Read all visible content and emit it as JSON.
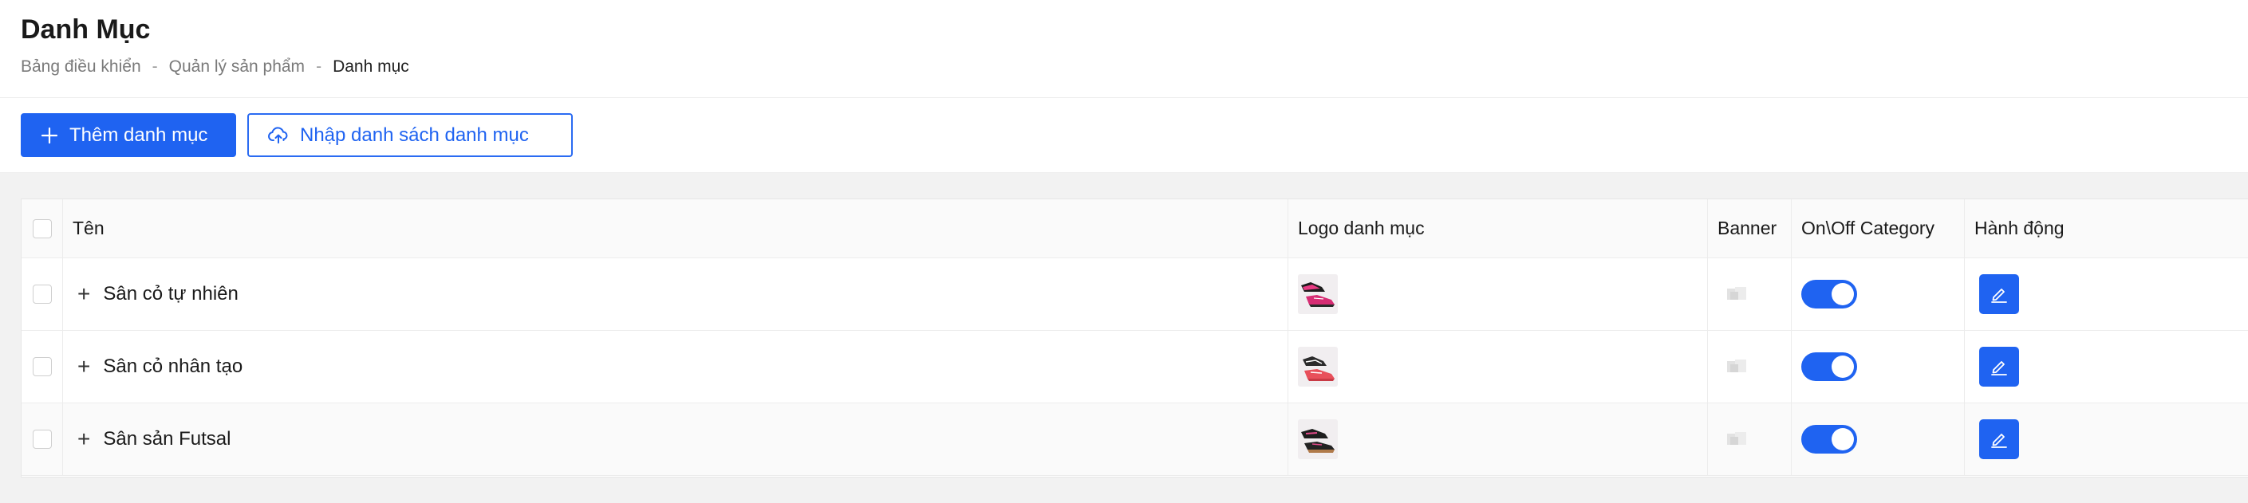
{
  "header": {
    "title": "Danh Mục",
    "breadcrumb": [
      "Bảng điều khiển",
      "Quản lý sản phẩm",
      "Danh mục"
    ],
    "separator": "-"
  },
  "toolbar": {
    "add_label": "Thêm danh mục",
    "import_label": "Nhập danh sách danh mục"
  },
  "table": {
    "columns": {
      "name": "Tên",
      "logo": "Logo danh mục",
      "banner": "Banner",
      "toggle": "On\\Off Category",
      "action": "Hành động"
    },
    "rows": [
      {
        "name": "Sân cỏ tự nhiên",
        "enabled": true,
        "logo_icon": "pink-boots-image"
      },
      {
        "name": "Sân cỏ nhân tạo",
        "enabled": true,
        "logo_icon": "red-white-boots-image"
      },
      {
        "name": "Sân sản Futsal",
        "enabled": true,
        "logo_icon": "black-pink-shoes-image"
      }
    ]
  },
  "colors": {
    "primary": "#1f63f1",
    "background": "#f2f2f2",
    "table_header": "#fafafa"
  }
}
